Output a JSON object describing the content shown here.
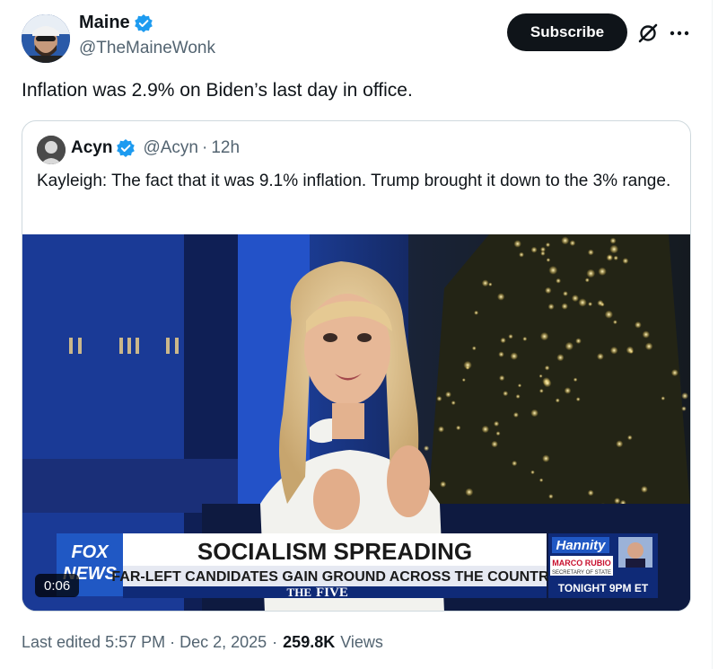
{
  "author": {
    "name": "Maine",
    "handle": "@TheMaineWonk"
  },
  "actions": {
    "subscribe_label": "Subscribe"
  },
  "tweet": {
    "text": "Inflation was 2.9% on Biden’s last day in office."
  },
  "quote": {
    "name": "Acyn",
    "handle": "@Acyn",
    "separator": "·",
    "time": "12h",
    "text": "Kayleigh: The fact that it was 9.1% inflation. Trump brought it down to the 3% range."
  },
  "video": {
    "duration": "0:06",
    "chyron": {
      "network_top": "FOX",
      "network_bottom": "NEWS",
      "headline": "SOCIALISM SPREADING",
      "subheadline": "FAR-LEFT CANDIDATES GAIN GROUND ACROSS THE COUNTRY",
      "show_prefix": "THE",
      "show_name": "FIVE",
      "promo_show": "Hannity",
      "promo_guest": "MARCO RUBIO",
      "promo_title": "SECRETARY OF STATE",
      "promo_time": "TONIGHT 9PM ET"
    }
  },
  "footer": {
    "edited": "Last edited 5:57 PM · Dec 2, 2025",
    "separator": "·",
    "views_count": "259.8K",
    "views_label": "Views"
  },
  "colors": {
    "accent_verified": "#1d9bf0",
    "text_primary": "#0f1419",
    "text_secondary": "#536471",
    "button_dark": "#0f1419"
  },
  "icons": [
    "verified-badge-icon",
    "grok-icon",
    "more-icon"
  ]
}
